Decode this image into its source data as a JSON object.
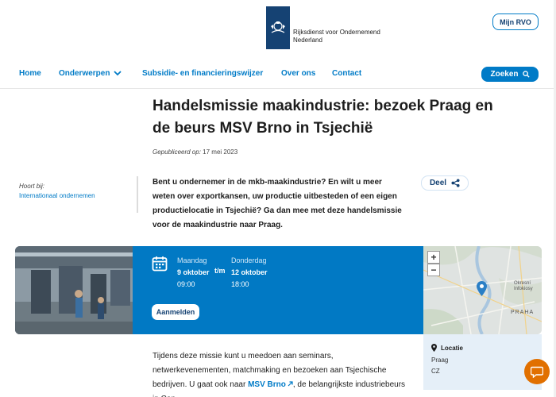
{
  "header": {
    "logo_line1": "Rijksdienst voor Ondernemend",
    "logo_line2": "Nederland",
    "mijn_rvo": "Mijn RVO",
    "nav": [
      {
        "label": "Home"
      },
      {
        "label": "Onderwerpen"
      },
      {
        "label": "Subsidie- en financieringswijzer"
      },
      {
        "label": "Over ons"
      },
      {
        "label": "Contact"
      }
    ],
    "search_label": "Zoeken"
  },
  "article": {
    "title": "Handelsmissie maakindustrie: bezoek Praag en de beurs MSV Brno in Tsjechië",
    "published_label": "Gepubliceerd op:",
    "published_date": "17 mei 2023",
    "hoort_label": "Hoort bij:",
    "hoort_link": "Internationaal ondernemen",
    "intro": "Bent u ondernemer in de mkb-maakindustrie? En wilt u meer weten over exportkansen, uw productie uitbesteden of een eigen productielocatie in Tsjechië? Ga dan mee met deze handelsmissie voor de maakindustrie naar Praag.",
    "share_label": "Deel",
    "body_part1": "Tijdens deze missie kunt u meedoen aan seminars, netwerkevenementen, matchmaking en bezoeken aan Tsjechische bedrijven. U gaat ook naar ",
    "body_link": "MSV Brno",
    "body_part2": ", de belangrijkste industriebeurs in Cen-"
  },
  "event": {
    "start_day": "Maandag",
    "start_date": "9 oktober",
    "start_time": "09:00",
    "separator": "t/m",
    "end_day": "Donderdag",
    "end_date": "12 oktober",
    "end_time": "18:00",
    "register_label": "Aanmelden"
  },
  "map": {
    "zoom_in": "+",
    "zoom_out": "−",
    "label_praha": "PRAHA",
    "label_district": "Okresní\nInfokiosy"
  },
  "location": {
    "title": "Locatie",
    "city": "Praag",
    "country": "CZ"
  },
  "colors": {
    "brand_dark": "#154273",
    "accent": "#007bc7",
    "event_blue": "#0179c4",
    "chat_orange": "#e17000"
  }
}
